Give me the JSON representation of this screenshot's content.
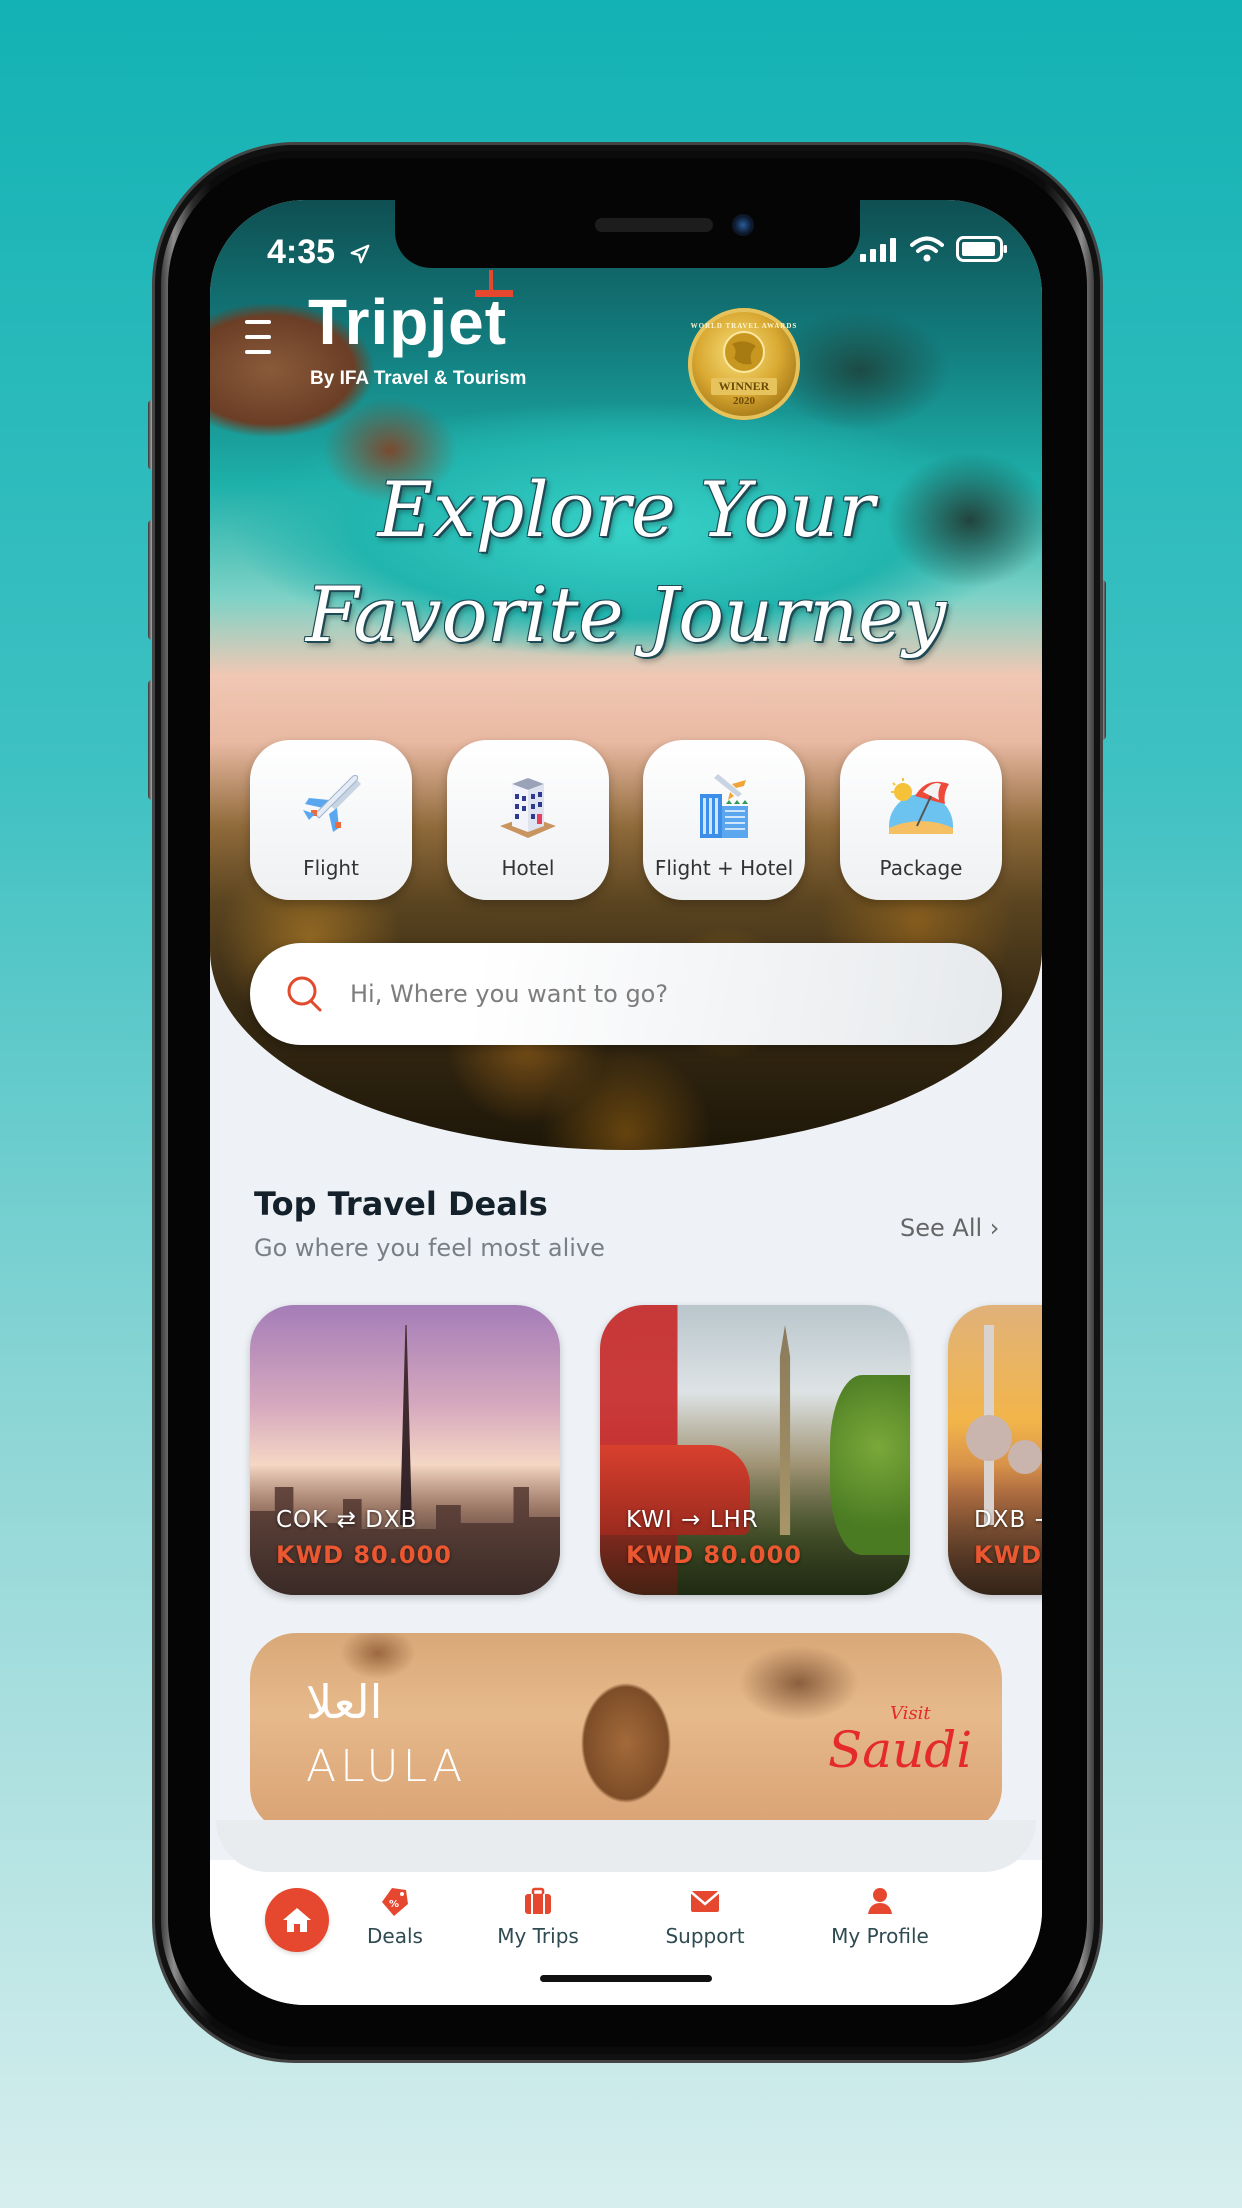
{
  "status_bar": {
    "time": "4:35"
  },
  "header": {
    "logo_text": "Tripjet",
    "logo_subtitle": "By IFA Travel & Tourism",
    "award": {
      "arc_text": "WORLD TRAVEL AWARDS",
      "ribbon": "WINNER",
      "year": "2020"
    }
  },
  "hero": {
    "headline_line1": "Explore Your",
    "headline_line2": "Favorite Journey"
  },
  "categories": [
    {
      "label": "Flight",
      "icon": "airplane-icon"
    },
    {
      "label": "Hotel",
      "icon": "hotel-building-icon"
    },
    {
      "label": "Flight + Hotel",
      "icon": "flight-hotel-icon"
    },
    {
      "label": "Package",
      "icon": "beach-umbrella-icon"
    }
  ],
  "search": {
    "placeholder": "Hi, Where you want to go?",
    "value": ""
  },
  "deals_section": {
    "title": "Top Travel Deals",
    "subtitle": "Go where you feel most alive",
    "see_all": "See All ›",
    "deals": [
      {
        "origin": "COK",
        "arrow": "⇄",
        "destination": "DXB",
        "price": "KWD 80.000"
      },
      {
        "origin": "KWI",
        "arrow": "→",
        "destination": "LHR",
        "price": "KWD 80.000"
      },
      {
        "origin": "DXB",
        "arrow": "→",
        "destination": "",
        "price": "KWD"
      }
    ]
  },
  "banner": {
    "arabic": "العلا",
    "title": "ALULA",
    "visit": "Visit",
    "brand": "Saudi"
  },
  "bottom_nav": {
    "items": [
      {
        "label": "",
        "icon": "home-icon",
        "active": true
      },
      {
        "label": "Deals",
        "icon": "deals-tag-icon"
      },
      {
        "label": "My Trips",
        "icon": "suitcase-icon"
      },
      {
        "label": "Support",
        "icon": "envelope-icon"
      },
      {
        "label": "My Profile",
        "icon": "user-icon"
      }
    ]
  },
  "colors": {
    "accent": "#e5482e",
    "price": "#ea5730",
    "nav_text": "#2f4b52",
    "background_top": "#13b2b4"
  }
}
